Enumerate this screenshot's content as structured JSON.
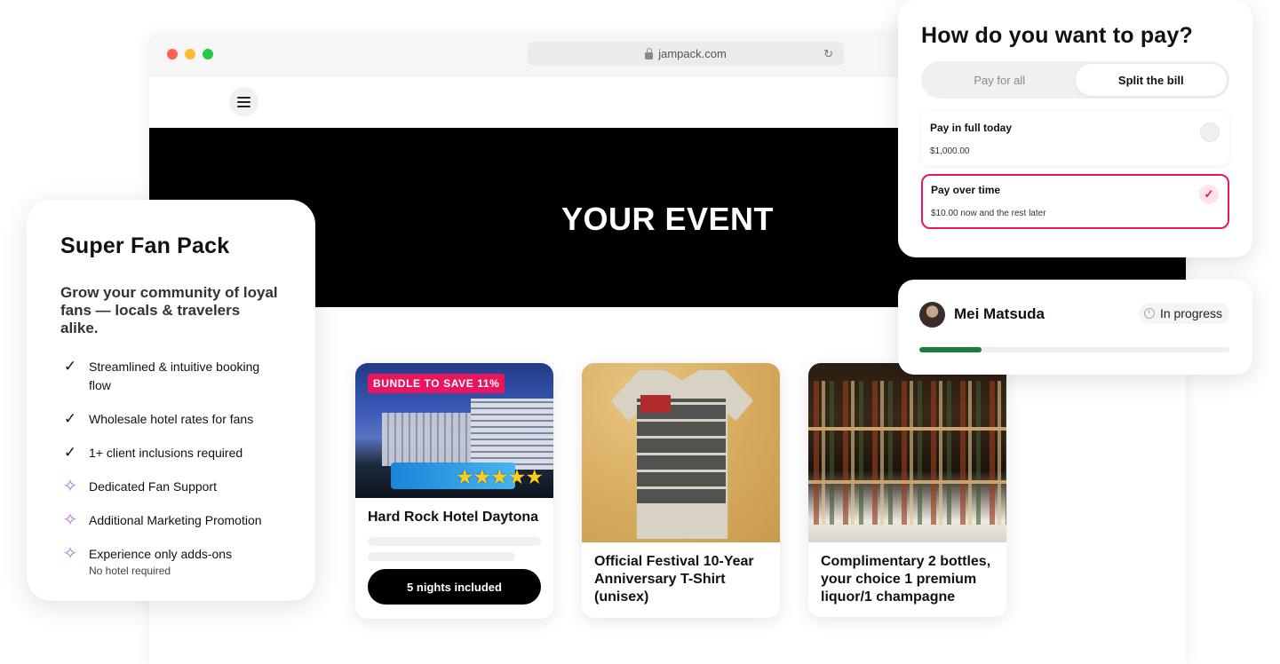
{
  "browser": {
    "url": "jampack.com"
  },
  "hero": {
    "title": "YOUR EVENT"
  },
  "cards": [
    {
      "title": "Hard Rock Hotel Daytona",
      "badge": "BUNDLE TO SAVE 11%",
      "stars": "★★★★★",
      "rating": 5,
      "button": "5 nights included"
    },
    {
      "title": "Official Festival 10-Year Anniversary T-Shirt (unisex)"
    },
    {
      "title": "Complimentary 2 bottles, your choice 1 premium liquor/1 champagne"
    }
  ],
  "fan_pack": {
    "title": "Super Fan Pack",
    "subtitle": "Grow your community of loyal fans — locals & travelers alike.",
    "features": [
      {
        "icon": "check-icon",
        "label": "Streamlined & intuitive booking flow"
      },
      {
        "icon": "check-icon",
        "label": "Wholesale hotel rates for fans"
      },
      {
        "icon": "check-icon",
        "label": "1+ client inclusions required"
      },
      {
        "icon": "sparkle-icon",
        "label": "Dedicated Fan Support"
      },
      {
        "icon": "sparkle-icon",
        "label": "Additional Marketing Promotion"
      },
      {
        "icon": "sparkle-icon",
        "label": "Experience only adds-ons",
        "note": "No hotel required"
      }
    ]
  },
  "payment": {
    "title": "How do you want to pay?",
    "tabs": [
      {
        "label": "Pay for all",
        "active": false
      },
      {
        "label": "Split the bill",
        "active": true
      }
    ],
    "options": [
      {
        "label": "Pay in full today",
        "detail": "$1,000.00",
        "selected": false
      },
      {
        "label": "Pay over time",
        "detail": "$10.00 now and the rest later",
        "selected": true
      }
    ]
  },
  "progress": {
    "user_name": "Mei Matsuda",
    "status": "In progress",
    "fraction": 0.2
  },
  "colors": {
    "accent": "#e8175d",
    "progress": "#19803a",
    "stars": "#ffcc1a",
    "sparkle": "#b573d6"
  }
}
